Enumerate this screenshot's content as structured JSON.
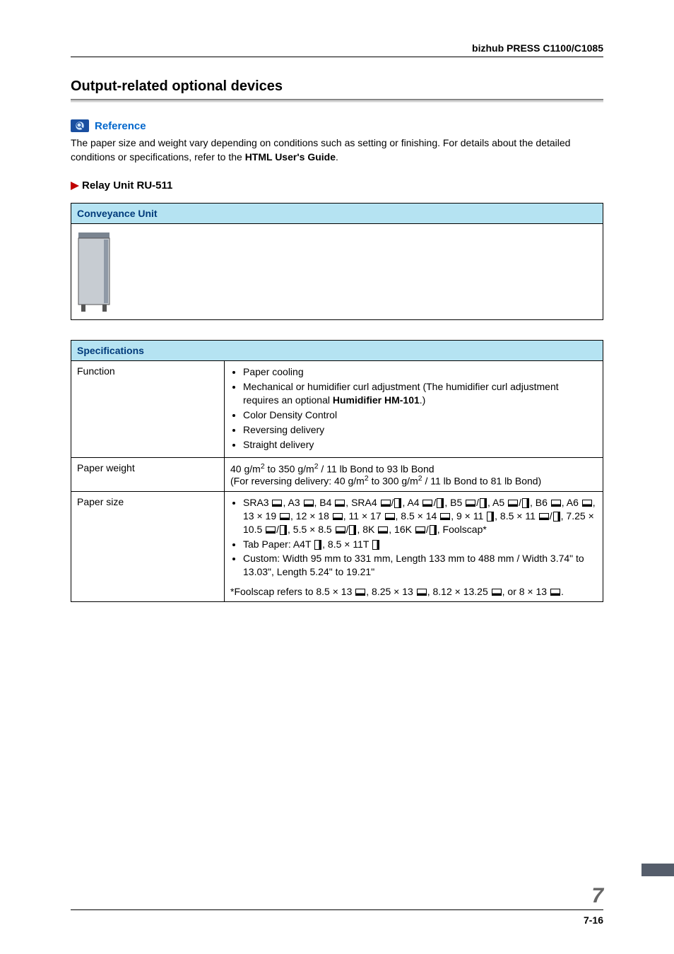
{
  "header": {
    "product": "bizhub PRESS C1100/C1085"
  },
  "section": {
    "title": "Output-related optional devices"
  },
  "reference": {
    "label": "Reference",
    "text_before": "The paper size and weight vary depending on conditions such as setting or finishing. For details about the detailed conditions or specifications, refer to the ",
    "bold": "HTML User's Guide",
    "text_after": "."
  },
  "subsection": {
    "title": "Relay Unit RU-511"
  },
  "conveyance": {
    "header": "Conveyance Unit"
  },
  "spec": {
    "header": "Specifications",
    "rows": {
      "function": {
        "label": "Function",
        "items": {
          "b1": "Paper cooling",
          "b2_before": "Mechanical or humidifier curl adjustment (The humidifier curl adjustment requires an optional ",
          "b2_bold": "Humidifier HM-101",
          "b2_after": ".)",
          "b3": "Color Density Control",
          "b4": "Reversing delivery",
          "b5": "Straight delivery"
        }
      },
      "paper_weight": {
        "label": "Paper weight",
        "line1_a": "40 g/m",
        "line1_b": " to 350 g/m",
        "line1_c": " / 11 lb Bond to 93 lb Bond",
        "line2_a": "(For reversing delivery: 40 g/m",
        "line2_b": " to 300 g/m",
        "line2_c": " / 11 lb Bond to 81 lb Bond)"
      },
      "paper_size": {
        "label": "Paper size",
        "line1_parts": [
          "SRA3 ",
          ", A3 ",
          ", B4 ",
          ", SRA4 ",
          "/",
          ", A4 ",
          "/",
          ", B5 ",
          "/",
          ", A5 ",
          "/",
          ", B6 ",
          ", A6 ",
          ","
        ],
        "line2_parts": [
          "13 × 19 ",
          ", 12 × 18 ",
          ", 11 × 17 ",
          ", 8.5 × 14 ",
          ", 9 × 11 ",
          ", 8.5 × 11 ",
          "/",
          ", 7.25 × 10.5 ",
          "/",
          ", 5.5 × 8.5 ",
          "/",
          ", 8K ",
          ", 16K ",
          "/",
          ", Foolscap*"
        ],
        "tab_a": "Tab Paper: A4T ",
        "tab_b": ", 8.5 × 11T ",
        "custom": "Custom: Width 95 mm to 331 mm, Length 133 mm to 488 mm / Width 3.74\" to 13.03\", Length 5.24\" to 19.21\"",
        "foolscap_a": "*Foolscap refers to 8.5 × 13 ",
        "foolscap_b": ", 8.25 × 13 ",
        "foolscap_c": ", 8.12 × 13.25 ",
        "foolscap_d": ", or 8 × 13 ",
        "foolscap_e": "."
      }
    }
  },
  "footer": {
    "chapter": "7",
    "page": "7-16"
  }
}
